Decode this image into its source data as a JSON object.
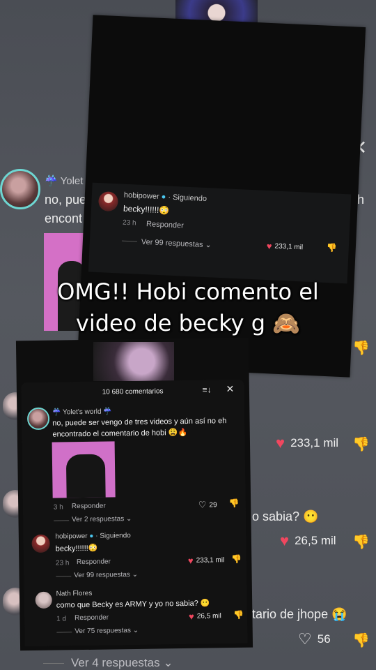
{
  "background": {
    "comment1": {
      "username": "Yolet",
      "text_line1_left": "no, pue",
      "text_line1_right": "eh",
      "text_line2": "encont"
    },
    "like1": "233,1 mil",
    "comment2_tail": "o sabia?",
    "like2": "26,5 mil",
    "comment3_tail": "tario de jhope",
    "like3": "56",
    "view_replies": "Ver 4 respuestas"
  },
  "top_panel": {
    "username": "hobipower",
    "following": "· Siguiendo",
    "text": "becky!!!!!!",
    "time": "23 h",
    "reply": "Responder",
    "view_replies": "Ver 99 respuestas",
    "likes": "233,1 mil"
  },
  "caption": {
    "line1": "OMG!! Hobi comento el",
    "line2": "video de becky g 🙈"
  },
  "bottom_panel": {
    "title": "10 680 comentarios",
    "comments": [
      {
        "username": "☔ Yolet's world ☔",
        "text_line1": "no, puede ser vengo de tres videos y aún así no eh",
        "text_line2": "encontrado el comentario de hobi 😩🔥",
        "time": "3 h",
        "reply": "Responder",
        "likes": "29",
        "view_replies": "Ver 2 respuestas"
      },
      {
        "username": "hobipower",
        "following": "· Siguiendo",
        "text": "becky!!!!!!😳",
        "time": "23 h",
        "reply": "Responder",
        "likes": "233,1 mil",
        "view_replies": "Ver 99 respuestas"
      },
      {
        "username": "Nath Flores",
        "text": "como que Becky es ARMY y yo no sabia? 😶",
        "time": "1 d",
        "reply": "Responder",
        "likes": "26,5 mil",
        "view_replies": "Ver 75 respuestas"
      }
    ]
  },
  "colors": {
    "like_red": "#f0475f",
    "verified_blue": "#4bc8f0",
    "avatar_ring": "#6ed6d2",
    "pink_media": "#d070c8"
  }
}
